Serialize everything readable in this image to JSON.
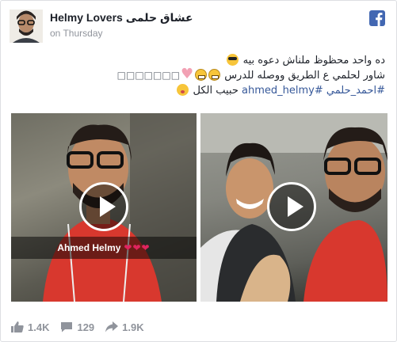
{
  "page": {
    "name": "Helmy Lovers",
    "name_ar": "عشاق حلمى",
    "time": "on Thursday"
  },
  "post": {
    "line1": "ده واحد محظوظ ملناش دعوه بيه",
    "line2": "شاور لحلمي ع الطريق ووصله للدرس",
    "line2_boxes": "□□□□□□□",
    "line3_hashtag_ar": "#احمد_حلمي",
    "line3_hashtag_en": "#ahmed_helmy",
    "line3_text": "حبيب الكل"
  },
  "videos": [
    {
      "caption": "Ahmed Helmy",
      "hearts": "❤❤❤"
    },
    {
      "caption": ""
    }
  ],
  "stats": {
    "likes": "1.4K",
    "comments": "129",
    "shares": "1.9K"
  },
  "colors": {
    "brand": "#4267b2",
    "link": "#365899",
    "muted": "#90949c"
  },
  "icons": [
    "facebook-icon",
    "play-icon",
    "like-icon",
    "comment-icon",
    "share-icon"
  ]
}
